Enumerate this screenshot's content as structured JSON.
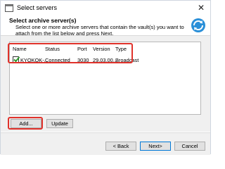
{
  "window": {
    "title": "Select servers"
  },
  "header": {
    "title": "Select archive server(s)",
    "description": "Select one or more archive servers that contain the vault(s) you want to attach from the list below and press Next."
  },
  "list": {
    "columns": [
      "Name",
      "Status",
      "Port",
      "Version",
      "Type"
    ],
    "rows": [
      {
        "checked": true,
        "name": "KYOKOK-...",
        "status": "Connected",
        "port": "3030",
        "version": "29.03.00...",
        "type": "Broadcast"
      }
    ]
  },
  "buttons": {
    "add": "Add...",
    "update": "Update",
    "back": "< Back",
    "next": "Next>",
    "cancel": "Cancel"
  },
  "colors": {
    "highlight": "#e0322b",
    "accent": "#0078d7"
  }
}
